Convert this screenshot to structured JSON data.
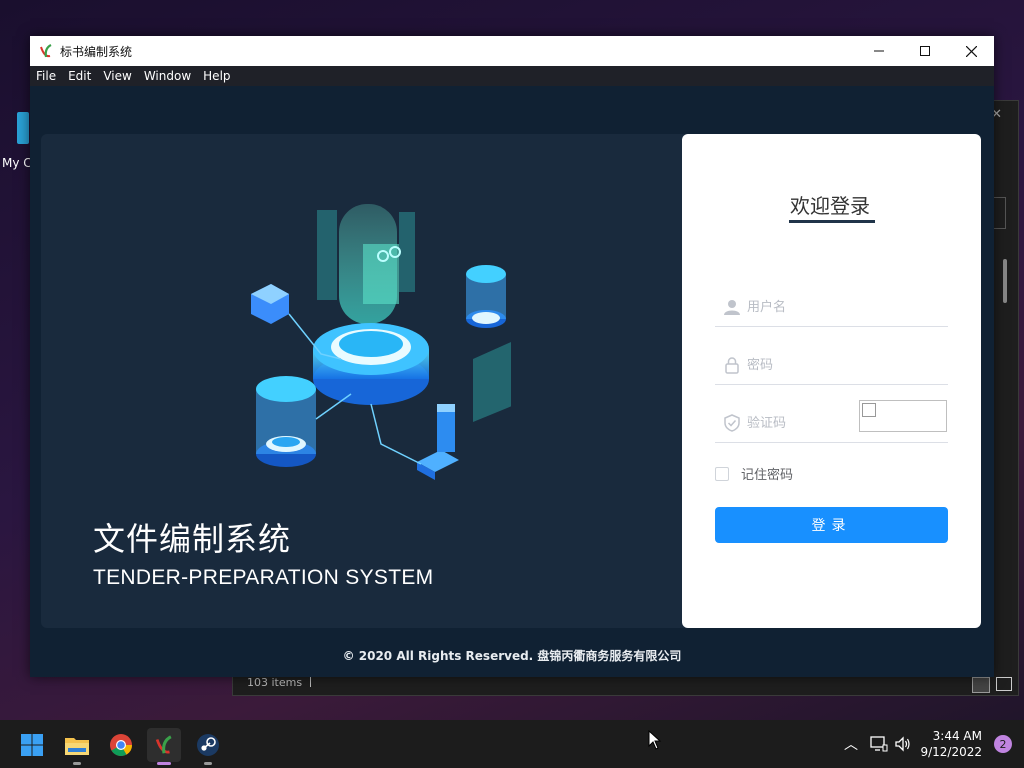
{
  "desktop": {
    "icon_label": "My C"
  },
  "explorer": {
    "status": "103 items"
  },
  "app": {
    "title": "标书编制系统",
    "menu": [
      "File",
      "Edit",
      "View",
      "Window",
      "Help"
    ],
    "hero": {
      "title": "文件编制系统",
      "subtitle": "TENDER-PREPARATION SYSTEM"
    },
    "login": {
      "title": "欢迎登录",
      "username_placeholder": "用户名",
      "password_placeholder": "密码",
      "captcha_placeholder": "验证码",
      "remember_label": "记住密码",
      "remember_checked": false,
      "submit_label": "登录"
    },
    "copyright": "© 2020 All Rights Reserved. 盘锦丙衢商务服务有限公司"
  },
  "taskbar": {
    "time": "3:44 AM",
    "date": "9/12/2022",
    "notifications": "2"
  },
  "colors": {
    "primary_button": "#1890ff",
    "hero_bg": "#192a3d",
    "client_bg": "#102133"
  }
}
